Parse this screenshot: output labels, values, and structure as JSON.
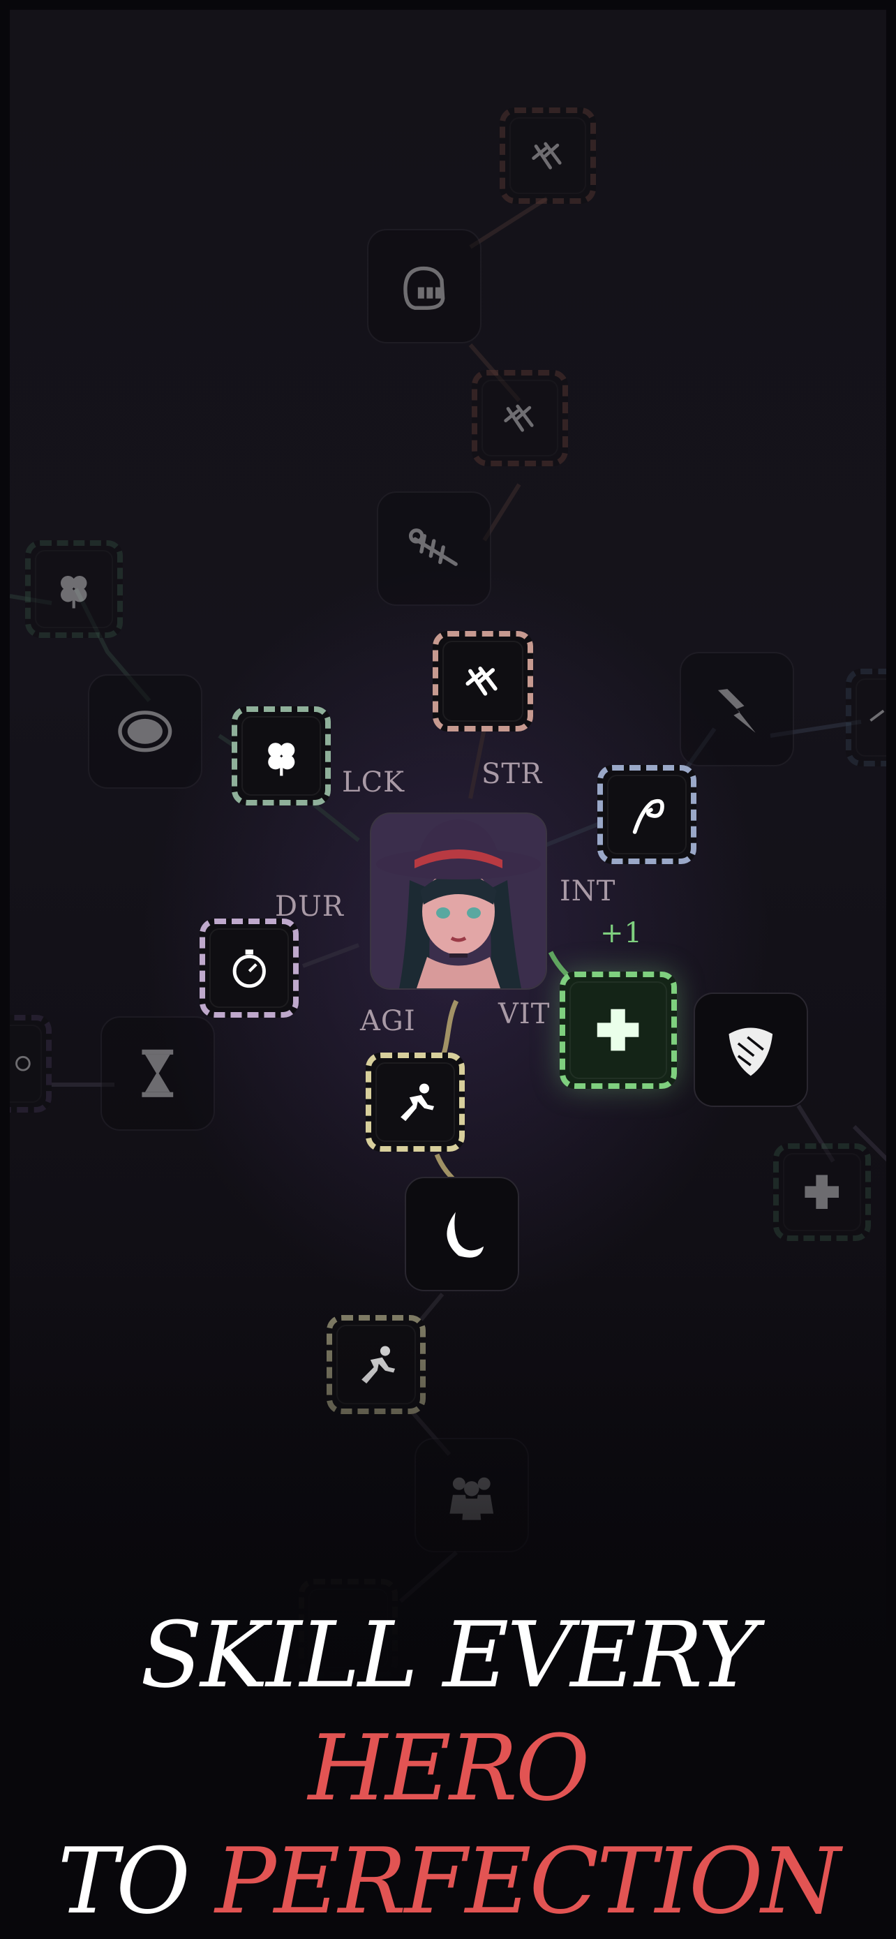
{
  "stats": {
    "lck": "LCK",
    "str": "STR",
    "int": "INT",
    "dur": "DUR",
    "agi": "AGI",
    "vit": "VIT",
    "bonus": "+1"
  },
  "hero": {
    "portrait_name": "witch-hero-portrait"
  },
  "skill_nodes": [
    {
      "icon": "claw-marks-icon",
      "state": "locked"
    },
    {
      "icon": "fist-icon",
      "state": "locked"
    },
    {
      "icon": "claw-marks-icon",
      "state": "locked"
    },
    {
      "icon": "fishbone-icon",
      "state": "locked"
    },
    {
      "icon": "claw-marks-icon",
      "state": "unlocked"
    },
    {
      "icon": "clover-icon",
      "state": "locked"
    },
    {
      "icon": "coin-icon",
      "state": "locked"
    },
    {
      "icon": "clover-icon",
      "state": "unlocked"
    },
    {
      "icon": "lightning-icon",
      "state": "locked"
    },
    {
      "icon": "swirl-icon",
      "state": "unlocked"
    },
    {
      "icon": "stopwatch-icon",
      "state": "unlocked"
    },
    {
      "icon": "hourglass-icon",
      "state": "locked"
    },
    {
      "icon": "heal-cross-icon",
      "state": "selected"
    },
    {
      "icon": "shield-icon",
      "state": "unlocked"
    },
    {
      "icon": "heal-cross-icon",
      "state": "locked"
    },
    {
      "icon": "sprint-icon",
      "state": "unlocked"
    },
    {
      "icon": "crescent-slash-icon",
      "state": "unlocked"
    },
    {
      "icon": "sprint-icon",
      "state": "unlocked"
    },
    {
      "icon": "crowd-icon",
      "state": "locked"
    }
  ],
  "tagline": {
    "line1_white": "SKILL EVERY",
    "line1_accent": "HERO",
    "line2_white": "TO",
    "line2_accent": "PERFECTION"
  },
  "colors": {
    "accent": "#e25453",
    "selected": "#7fd07f",
    "strength": "#c79a90",
    "luck": "#8fb09a",
    "agility": "#d8cf9c",
    "durability": "#bfa9cc",
    "intellect": "#9aa8c8"
  }
}
